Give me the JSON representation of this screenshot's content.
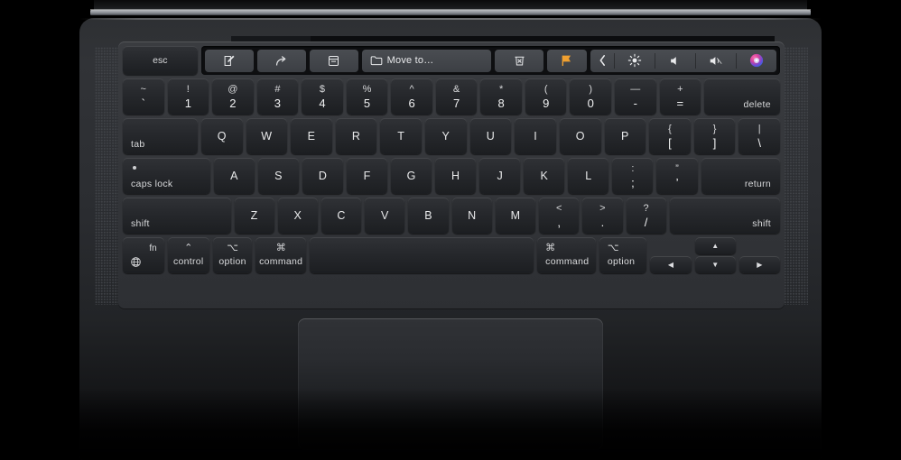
{
  "device": {
    "name": "MacBook Pro",
    "finish": "Space Gray",
    "accent_color": "#f0a030",
    "chassis_color": "#2e3033",
    "key_color": "#26282c",
    "touchbar_bg": "#0e0f11"
  },
  "touchbar": {
    "esc_label": "esc",
    "buttons": [
      {
        "name": "compose",
        "icon": "compose-icon",
        "label": ""
      },
      {
        "name": "reply",
        "icon": "reply-arrow-icon",
        "label": ""
      },
      {
        "name": "archive",
        "icon": "archive-box-icon",
        "label": ""
      }
    ],
    "move_to": {
      "icon": "folder-icon",
      "label": "Move to…"
    },
    "delete": {
      "icon": "trash-icon",
      "label": ""
    },
    "flag": {
      "icon": "flag-icon",
      "label": "",
      "color": "#f0a030"
    },
    "controls": [
      {
        "name": "expand-control-strip",
        "icon": "chevron-left-icon"
      },
      {
        "name": "brightness",
        "icon": "brightness-icon"
      },
      {
        "name": "volume",
        "icon": "speaker-icon"
      },
      {
        "name": "mute",
        "icon": "speaker-mute-icon"
      },
      {
        "name": "siri",
        "icon": "siri-icon"
      }
    ]
  },
  "keyboard": {
    "rows": {
      "numbers": [
        {
          "name": "tilde",
          "top": "~",
          "bottom": "`"
        },
        {
          "name": "one",
          "top": "!",
          "bottom": "1"
        },
        {
          "name": "two",
          "top": "@",
          "bottom": "2"
        },
        {
          "name": "three",
          "top": "#",
          "bottom": "3"
        },
        {
          "name": "four",
          "top": "$",
          "bottom": "4"
        },
        {
          "name": "five",
          "top": "%",
          "bottom": "5"
        },
        {
          "name": "six",
          "top": "^",
          "bottom": "6"
        },
        {
          "name": "seven",
          "top": "&",
          "bottom": "7"
        },
        {
          "name": "eight",
          "top": "*",
          "bottom": "8"
        },
        {
          "name": "nine",
          "top": "(",
          "bottom": "9"
        },
        {
          "name": "zero",
          "top": ")",
          "bottom": "0"
        },
        {
          "name": "minus",
          "top": "—",
          "bottom": "-"
        },
        {
          "name": "equal",
          "top": "+",
          "bottom": "="
        }
      ],
      "delete_label": "delete",
      "tab_label": "tab",
      "qwerty": [
        "Q",
        "W",
        "E",
        "R",
        "T",
        "Y",
        "U",
        "I",
        "O",
        "P"
      ],
      "qwerty_symbols": [
        {
          "name": "bracket-left",
          "top": "{",
          "bottom": "["
        },
        {
          "name": "bracket-right",
          "top": "}",
          "bottom": "]"
        },
        {
          "name": "backslash",
          "top": "|",
          "bottom": "\\"
        }
      ],
      "caps_label": "caps lock",
      "home": [
        "A",
        "S",
        "D",
        "F",
        "G",
        "H",
        "J",
        "K",
        "L"
      ],
      "home_symbols": [
        {
          "name": "semicolon",
          "top": ":",
          "bottom": ";"
        },
        {
          "name": "quote",
          "top": "”",
          "bottom": "’"
        }
      ],
      "return_label": "return",
      "shift_left_label": "shift",
      "bottom_letters": [
        "Z",
        "X",
        "C",
        "V",
        "B",
        "N",
        "M"
      ],
      "bottom_symbols": [
        {
          "name": "comma",
          "top": "<",
          "bottom": ","
        },
        {
          "name": "period",
          "top": ">",
          "bottom": "."
        },
        {
          "name": "slash",
          "top": "?",
          "bottom": "/"
        }
      ],
      "shift_right_label": "shift",
      "modifiers": {
        "fn_label": "fn",
        "fn_icon": "globe-icon",
        "control": {
          "symbol": "⌃",
          "label": "control"
        },
        "option_left": {
          "symbol": "⌥",
          "label": "option"
        },
        "command_left": {
          "symbol": "⌘",
          "label": "command"
        },
        "space": {
          "label": "",
          "name": "space-bar"
        },
        "command_right": {
          "symbol": "⌘",
          "label": "command"
        },
        "option_right": {
          "symbol": "⌥",
          "label": "option"
        }
      },
      "arrows": {
        "left": "◀",
        "up": "▲",
        "down": "▼",
        "right": "▶"
      }
    }
  },
  "trackpad": {
    "name": "trackpad",
    "label": ""
  }
}
